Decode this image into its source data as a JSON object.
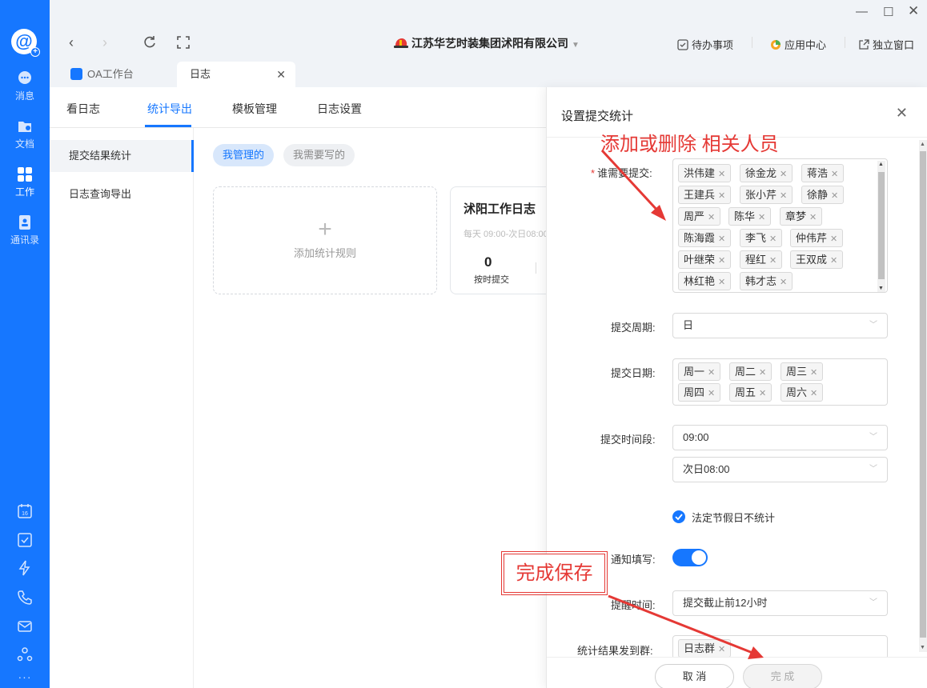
{
  "rail": {
    "items": [
      {
        "label": "消息",
        "icon": "message-icon"
      },
      {
        "label": "文档",
        "icon": "document-icon"
      },
      {
        "label": "工作",
        "icon": "work-grid-icon"
      },
      {
        "label": "通讯录",
        "icon": "contacts-icon"
      }
    ],
    "more": "···"
  },
  "topbar": {
    "company": "江苏华艺时装集团沭阳有限公司",
    "todo": "待办事项",
    "app_center": "应用中心",
    "standalone": "独立窗口"
  },
  "tabs": {
    "oa": "OA工作台",
    "log": "日志"
  },
  "subnav": [
    "看日志",
    "统计导出",
    "模板管理",
    "日志设置"
  ],
  "sidemenu": [
    "提交结果统计",
    "日志查询导出"
  ],
  "pills": {
    "managed": "我管理的",
    "mine": "我需要写的"
  },
  "add_card": {
    "plus": "+",
    "label": "添加统计规则"
  },
  "rule_card": {
    "title": "沭阳工作日志",
    "time": "每天 09:00-次日08:00",
    "count": "0",
    "count_label": "按时提交"
  },
  "drawer": {
    "title": "设置提交统计",
    "who_label": "谁需要提交:",
    "people": [
      "洪伟建",
      "徐金龙",
      "蒋浩",
      "王建兵",
      "张小芹",
      "徐静",
      "周严",
      "陈华",
      "章梦",
      "陈海霞",
      "李飞",
      "仲伟芹",
      "叶继荣",
      "程红",
      "王双成",
      "林红艳",
      "韩才志"
    ],
    "cycle_label": "提交周期:",
    "cycle_value": "日",
    "days_label": "提交日期:",
    "days": [
      "周一",
      "周二",
      "周三",
      "周四",
      "周五",
      "周六"
    ],
    "period_label": "提交时间段:",
    "period_start": "09:00",
    "period_end": "次日08:00",
    "holiday_label": "法定节假日不统计",
    "notify_label": "通知填写:",
    "remind_label": "提醒时间:",
    "remind_value": "提交截止前12小时",
    "group_label": "统计结果发到群:",
    "group_tag": "日志群",
    "cancel": "取 消",
    "confirm": "完 成"
  },
  "annotations": {
    "top": "添加或删除 相关人员",
    "bottom": "完成保存"
  },
  "colors": {
    "accent": "#1677ff",
    "annotation": "#e53935"
  }
}
